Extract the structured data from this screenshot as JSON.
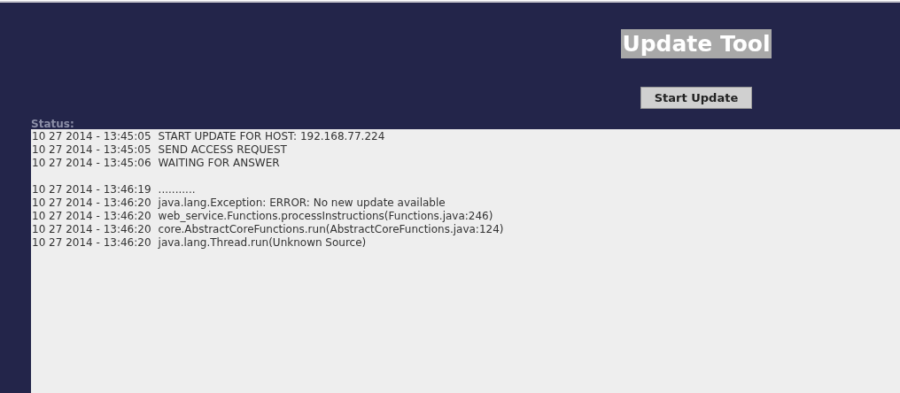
{
  "title": "Update Tool",
  "start_button": "Start Update",
  "status_label": "Status:",
  "log_blocks": [
    [
      {
        "time": "10 27 2014 - 13:45:05",
        "message": "START UPDATE FOR HOST: 192.168.77.224"
      },
      {
        "time": "10 27 2014 - 13:45:05",
        "message": "SEND ACCESS REQUEST"
      },
      {
        "time": "10 27 2014 - 13:45:06",
        "message": "WAITING FOR ANSWER"
      }
    ],
    [
      {
        "time": "10 27 2014 - 13:46:19",
        "message": "..........."
      },
      {
        "time": "10 27 2014 - 13:46:20",
        "message": "java.lang.Exception: ERROR: No new update available"
      },
      {
        "time": "10 27 2014 - 13:46:20",
        "message": "web_service.Functions.processInstructions(Functions.java:246)"
      },
      {
        "time": "10 27 2014 - 13:46:20",
        "message": "core.AbstractCoreFunctions.run(AbstractCoreFunctions.java:124)"
      },
      {
        "time": "10 27 2014 - 13:46:20",
        "message": "java.lang.Thread.run(Unknown Source)"
      }
    ]
  ]
}
